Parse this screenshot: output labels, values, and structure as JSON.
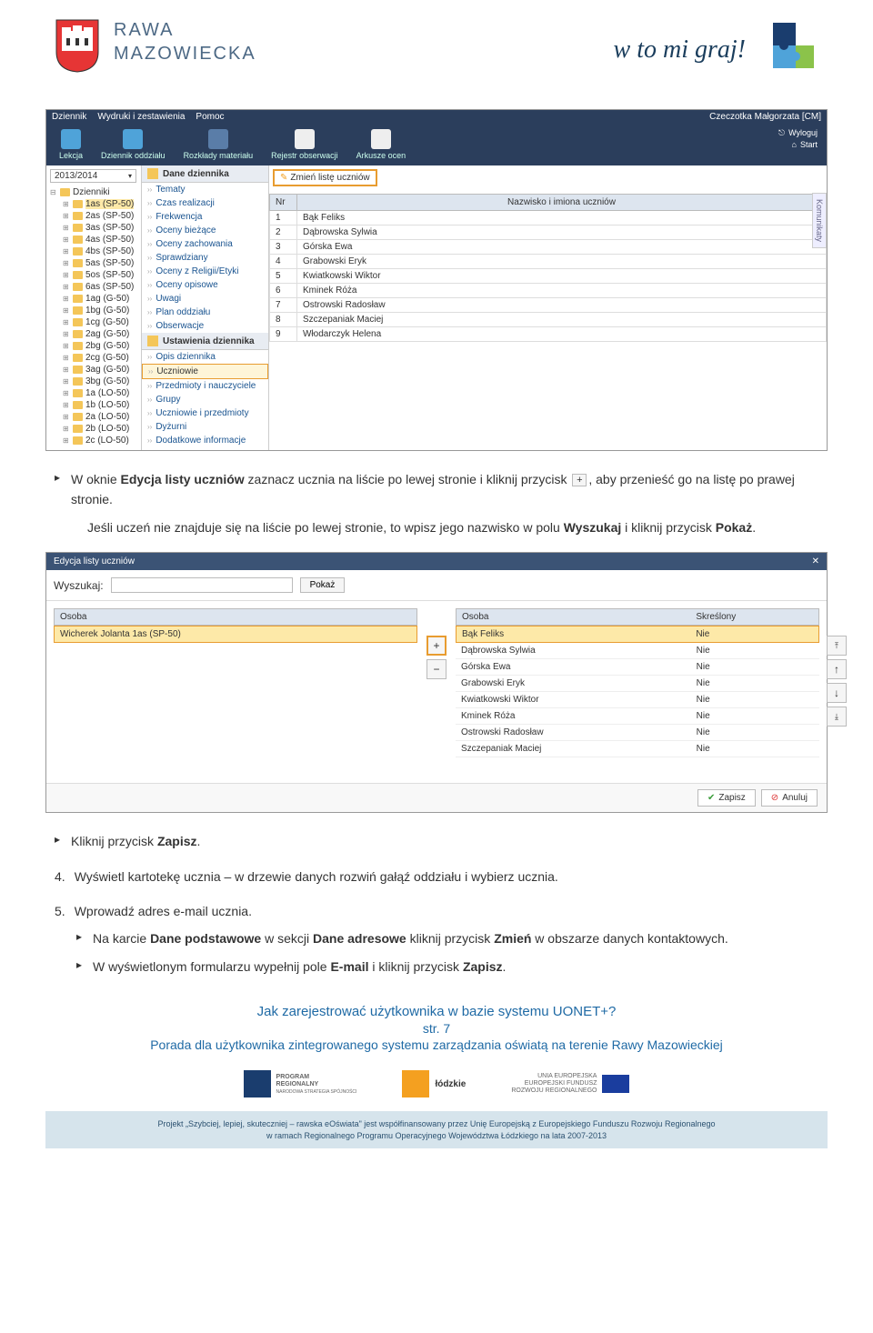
{
  "header": {
    "city_top": "RAWA",
    "city_bot": "MAZOWIECKA",
    "slogan": "w to mi graj!"
  },
  "ss1": {
    "menu": {
      "m1": "Dziennik",
      "m2": "Wydruki i zestawienia",
      "m3": "Pomoc",
      "user": "Czeczotka Małgorzata [CM]"
    },
    "toolbar": {
      "t1": "Lekcja",
      "t2": "Dziennik oddziału",
      "t3": "Rozkłady materiału",
      "t4": "Rejestr obserwacji",
      "t5": "Arkusze ocen"
    },
    "links": {
      "logout": "Wyloguj",
      "start": "Start"
    },
    "year": "2013/2014",
    "tree_root": "Dzienniki",
    "tree": [
      "1as (SP-50)",
      "2as (SP-50)",
      "3as (SP-50)",
      "4as (SP-50)",
      "4bs (SP-50)",
      "5as (SP-50)",
      "5os (SP-50)",
      "6as (SP-50)",
      "1ag (G-50)",
      "1bg (G-50)",
      "1cg (G-50)",
      "2ag (G-50)",
      "2bg (G-50)",
      "2cg (G-50)",
      "3ag (G-50)",
      "3bg (G-50)",
      "1a (LO-50)",
      "1b (LO-50)",
      "2a (LO-50)",
      "2b (LO-50)",
      "2c (LO-50)"
    ],
    "col2_header": "Dane dziennika",
    "col2_items": [
      "Tematy",
      "Czas realizacji",
      "Frekwencja",
      "Oceny bieżące",
      "Oceny zachowania",
      "Sprawdziany",
      "Oceny z Religii/Etyki",
      "Oceny opisowe",
      "Uwagi",
      "Plan oddziału",
      "Obserwacje"
    ],
    "col2_header2": "Ustawienia dziennika",
    "col2_items2": [
      "Opis dziennika",
      "Uczniowie",
      "Przedmioty i nauczyciele",
      "Grupy",
      "Uczniowie i przedmioty",
      "Dyżurni",
      "Dodatkowe informacje"
    ],
    "btn_zmien": "Zmień listę uczniów",
    "table_h1": "Nr",
    "table_h2": "Nazwisko i imiona uczniów",
    "students": [
      {
        "nr": "1",
        "name": "Bąk Feliks"
      },
      {
        "nr": "2",
        "name": "Dąbrowska Sylwia"
      },
      {
        "nr": "3",
        "name": "Górska Ewa"
      },
      {
        "nr": "4",
        "name": "Grabowski Eryk"
      },
      {
        "nr": "5",
        "name": "Kwiatkowski Wiktor"
      },
      {
        "nr": "6",
        "name": "Kminek Róża"
      },
      {
        "nr": "7",
        "name": "Ostrowski Radosław"
      },
      {
        "nr": "8",
        "name": "Szczepaniak Maciej"
      },
      {
        "nr": "9",
        "name": "Włodarczyk Helena"
      }
    ],
    "komunikaty": "Komunikaty"
  },
  "para1": {
    "p1a": "W oknie ",
    "p1b": "Edycja listy uczniów",
    "p1c": " zaznacz ucznia na liście po lewej stronie i kliknij przycisk ",
    "p1d": ", aby przenieść go na listę po prawej stronie.",
    "p2a": "Jeśli uczeń nie znajduje się na liście po lewej stronie, to wpisz jego nazwisko w polu ",
    "p2b": "Wyszukaj",
    "p2c": " i kliknij przycisk ",
    "p2d": "Pokaż",
    "p2e": "."
  },
  "ss2": {
    "title": "Edycja listy uczniów",
    "search_label": "Wyszukaj:",
    "search_btn": "Pokaż",
    "left_hdr": "Osoba",
    "left_sel": "Wicherek Jolanta 1as (SP-50)",
    "right_h1": "Osoba",
    "right_h2": "Skreślony",
    "right_rows": [
      {
        "name": "Bąk Feliks",
        "del": "Nie",
        "sel": true
      },
      {
        "name": "Dąbrowska Sylwia",
        "del": "Nie"
      },
      {
        "name": "Górska Ewa",
        "del": "Nie"
      },
      {
        "name": "Grabowski Eryk",
        "del": "Nie"
      },
      {
        "name": "Kwiatkowski Wiktor",
        "del": "Nie"
      },
      {
        "name": "Kminek Róża",
        "del": "Nie"
      },
      {
        "name": "Ostrowski Radosław",
        "del": "Nie"
      },
      {
        "name": "Szczepaniak Maciej",
        "del": "Nie"
      }
    ],
    "save": "Zapisz",
    "cancel": "Anuluj"
  },
  "para2": {
    "p1a": "Kliknij przycisk ",
    "p1b": "Zapisz",
    "p1c": "."
  },
  "step4": {
    "num": "4.",
    "text": "Wyświetl kartotekę ucznia – w drzewie danych rozwiń gałąź oddziału i wybierz ucznia."
  },
  "step5": {
    "num": "5.",
    "text": "Wprowadź adres e-mail ucznia.",
    "b1a": "Na karcie ",
    "b1b": "Dane podstawowe",
    "b1c": " w sekcji ",
    "b1d": "Dane adresowe",
    "b1e": " kliknij przycisk ",
    "b1f": "Zmień",
    "b1g": " w obszarze danych kontaktowych.",
    "b2a": "W wyświetlonym formularzu wypełnij pole ",
    "b2b": "E-mail",
    "b2c": " i kliknij przycisk ",
    "b2d": "Zapisz",
    "b2e": "."
  },
  "footer": {
    "title": "Jak zarejestrować użytkownika w bazie systemu UONET+?",
    "str": "str. 7",
    "sub": "Porada dla użytkownika zintegrowanego systemu zarządzania oświatą na terenie Rawy Mazowieckiej",
    "logo1a": "PROGRAM",
    "logo1b": "REGIONALNY",
    "logo1c": "NARODOWA STRATEGIA SPÓJNOŚCI",
    "logo2": "łódzkie",
    "logo3a": "UNIA EUROPEJSKA",
    "logo3b": "EUROPEJSKI FUNDUSZ",
    "logo3c": "ROZWOJU REGIONALNEGO",
    "bar1": "Projekt „Szybciej, lepiej, skuteczniej – rawska eOświata\" jest współfinansowany przez Unię Europejską z Europejskiego Funduszu Rozwoju Regionalnego",
    "bar2": "w ramach Regionalnego Programu Operacyjnego Województwa Łódzkiego na lata 2007-2013"
  }
}
